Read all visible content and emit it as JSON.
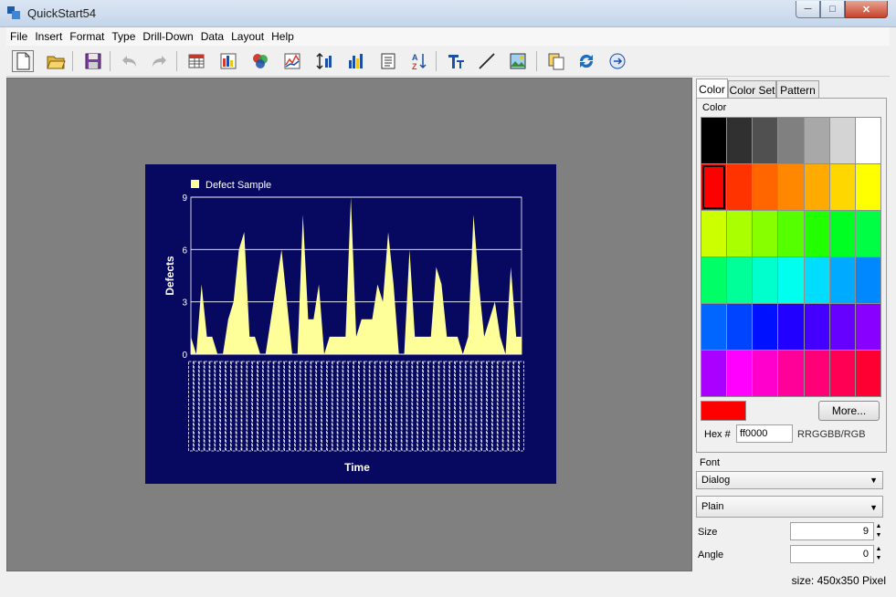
{
  "window": {
    "title": "QuickStart54"
  },
  "menu": [
    "File",
    "Insert",
    "Format",
    "Type",
    "Drill-Down",
    "Data",
    "Layout",
    "Help"
  ],
  "toolbar": {
    "icons": [
      "new-document-icon",
      "open-folder-icon",
      "save-icon",
      "undo-icon",
      "redo-icon",
      "table-icon",
      "chart-color-icon",
      "color-palette-icon",
      "line-chart-icon",
      "axis-scale-icon",
      "bar-chart-icon",
      "list-icon",
      "sort-az-icon",
      "text-format-icon",
      "line-draw-icon",
      "image-icon",
      "copy-pages-icon",
      "refresh-icon",
      "export-icon"
    ]
  },
  "chart_data": {
    "type": "area",
    "legend": [
      "Defect Sample"
    ],
    "legend_position": "top-left",
    "xlabel": "Time",
    "ylabel": "Defects",
    "ylim": [
      0,
      9
    ],
    "yticks": [
      0,
      3,
      6,
      9
    ],
    "grid": true,
    "colors": {
      "background": "#07085f",
      "fill": "#ffff99",
      "grid": "#ffffff",
      "text": "#ffffff"
    },
    "series": [
      {
        "name": "Defect Sample",
        "values": [
          1,
          0,
          4,
          1,
          1,
          0,
          0,
          2,
          3,
          6,
          7,
          1,
          1,
          0,
          0,
          2,
          4,
          6,
          3,
          0,
          0,
          8,
          2,
          2,
          4,
          0,
          1,
          1,
          1,
          1,
          9,
          1,
          2,
          2,
          2,
          4,
          3,
          7,
          4,
          0,
          0,
          6,
          1,
          1,
          1,
          1,
          5,
          4,
          1,
          1,
          1,
          0,
          1,
          8,
          4,
          1,
          2,
          3,
          1,
          0,
          5,
          1,
          1
        ]
      }
    ]
  },
  "side_panel": {
    "tabs": [
      "Color",
      "Color Set",
      "Pattern"
    ],
    "color_group_label": "Color",
    "swatches": [
      "#000000",
      "#303030",
      "#505050",
      "#808080",
      "#a8a8a8",
      "#d4d4d4",
      "#ffffff",
      "#ff0000",
      "#ff3300",
      "#ff6600",
      "#ff8800",
      "#ffaa00",
      "#ffd700",
      "#ffff00",
      "#ccff00",
      "#aaff00",
      "#88ff00",
      "#55ff00",
      "#22ff00",
      "#00ff22",
      "#00ff44",
      "#00ff66",
      "#00ff99",
      "#00ffcc",
      "#00ffee",
      "#00ddff",
      "#00aaff",
      "#0088ff",
      "#0066ff",
      "#0044ff",
      "#0011ff",
      "#2200ff",
      "#4400ff",
      "#6600ff",
      "#8800ff",
      "#aa00ff",
      "#ff00ff",
      "#ff00cc",
      "#ff0099",
      "#ff0077",
      "#ff0055",
      "#ff0033"
    ],
    "selected_color": "#ff0000",
    "more_label": "More...",
    "hex_label": "Hex #",
    "hex_value": "ff0000",
    "hex_format": "RRGGBB/RGB",
    "font_label": "Font",
    "font_family": "Dialog",
    "font_style": "Plain",
    "size_label": "Size",
    "size_value": "9",
    "angle_label": "Angle",
    "angle_value": "0"
  },
  "status": {
    "size_text": "size: 450x350 Pixel"
  }
}
